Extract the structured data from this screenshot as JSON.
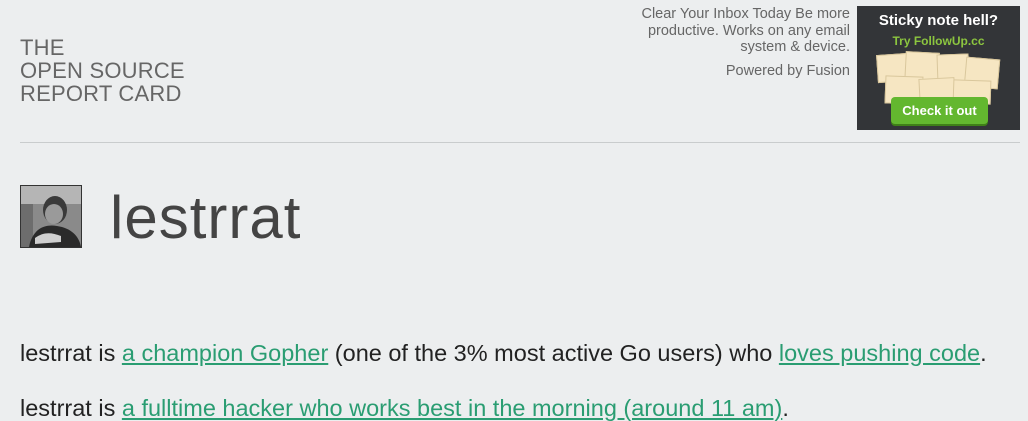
{
  "header": {
    "site_title": [
      "THE",
      "OPEN SOURCE",
      "REPORT CARD"
    ]
  },
  "ad": {
    "description": "Clear Your Inbox Today Be more productive. Works on any email system & device.",
    "powered_by": "Powered by Fusion",
    "banner": {
      "headline": "Sticky note hell?",
      "subline": "Try FollowUp.cc",
      "cta_label": "Check it out"
    }
  },
  "profile": {
    "username": "lestrrat",
    "summary": {
      "s1_prefix": "lestrrat is ",
      "s1_link": "a champion Gopher",
      "s1_middle": " (one of the 3% most active Go users) who ",
      "s1_link2": "loves pushing code",
      "s1_end": ". lestrrat is ",
      "s2_link": "a fulltime hacker who works best in the morning (around 11 am)",
      "s2_end": "."
    }
  },
  "colors": {
    "background": "#eceeef",
    "link": "#2a9d72",
    "ad_cta": "#63b72f"
  }
}
